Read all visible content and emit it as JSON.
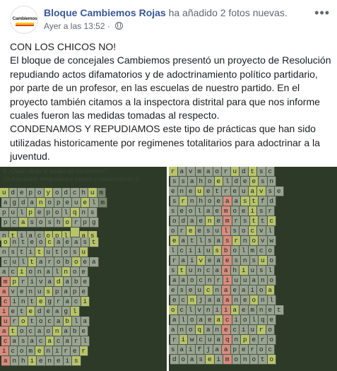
{
  "post": {
    "page_name": "Bloque Cambiemos Rojas",
    "action": " ha añadido 2 fotos nuevas.",
    "timestamp": "Ayer a las 13:52",
    "avatar_logo": "Cambiemos",
    "paragraphs": [
      "CON LOS CHICOS NO!",
      "El bloque de concejales Cambiemos presentó un proyecto de Resolución repudiando actos difamatorios y de adoctrinamiento político partidario, por parte de un profesor, en las escuelas de nuestro partido. En el proyecto también citamos a la inspectora distrital para que nos informe cuales fueron las medidas tomadas al respecto.",
      "CONDENAMOS Y REPUDIAMOS este tipo de prácticas que han sido utilizadas historicamente por regimenes totalitarios para adoctrinar a la juventud."
    ]
  },
  "photo_left": {
    "question_1": "9-¿Quién dirige al equipo de conducción?",
    "question_2": "10-Asociación integrada por padres y colaboradores d",
    "rows": [
      "udepoyodchum",
      "agdanopeuelm",
      "pulpepolqns",
      "pcasoshorpg",
      "ntiacopl as",
      "onteocaeast",
      "nstitutosu",
      "cultaroboea",
      "acionalnoe",
      "mprivadabe",
      "avenuspape",
      "cintegraci",
      "ietedeagl",
      "urotocabla",
      "atocaonabe",
      "casacacarl",
      "icomenirer",
      "anhieneis"
    ]
  },
  "photo_right": {
    "rows": [
      "ravmaorudtsc",
      "ssahoeldeesn",
      "eneuetreuavse",
      "srnhoeaastfd",
      "seolaemoeisr",
      "odaenemrsttc",
      "oreesulsocvl",
      "eatlsasrnovw",
      "lciiusbolmco",
      "raiveaesnsuo",
      "stuncaahiusl",
      "aaocnriuuano",
      "eseucnaeaioa",
      "ecnjaaaneonl",
      "oclvniiaemnet",
      "aloaeaciolqe",
      "anoqaneciuro",
      "riwcuaqnpero",
      "saifjaaperoc",
      "doaseimonoto"
    ]
  }
}
